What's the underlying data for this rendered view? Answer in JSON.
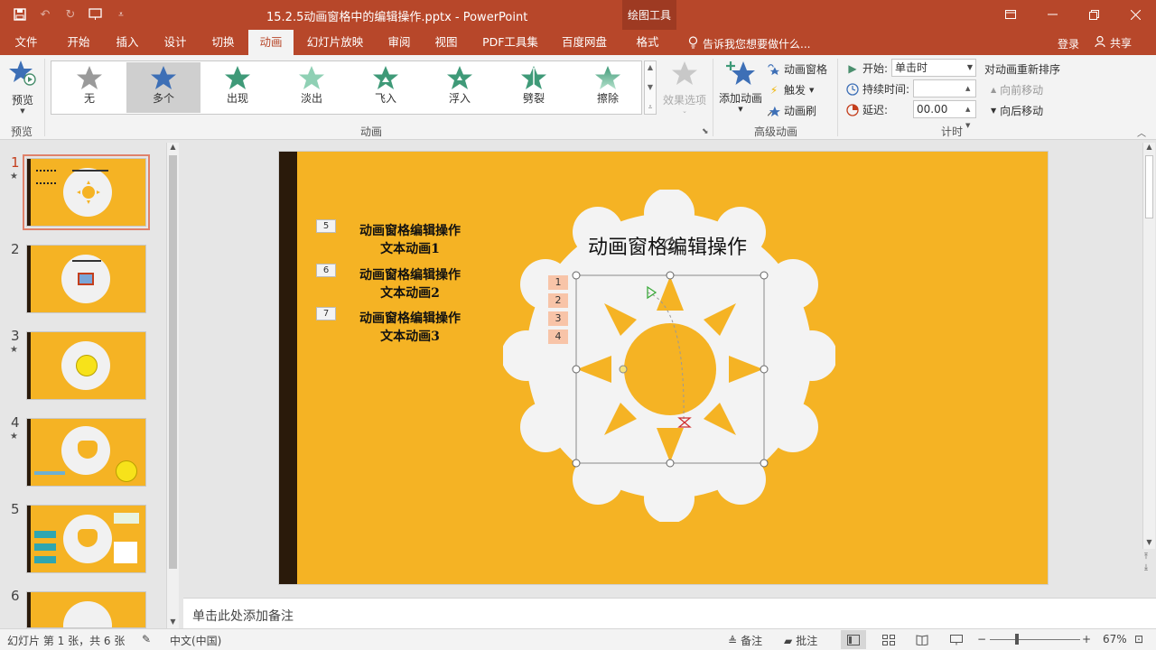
{
  "titlebar": {
    "doc_title": "15.2.5动画窗格中的编辑操作.pptx - PowerPoint",
    "context_tab": "绘图工具"
  },
  "tabs": [
    {
      "label": "文件"
    },
    {
      "label": "开始"
    },
    {
      "label": "插入"
    },
    {
      "label": "设计"
    },
    {
      "label": "切换"
    },
    {
      "label": "动画"
    },
    {
      "label": "幻灯片放映"
    },
    {
      "label": "审阅"
    },
    {
      "label": "视图"
    },
    {
      "label": "PDF工具集"
    },
    {
      "label": "百度网盘"
    },
    {
      "label": "格式"
    }
  ],
  "tellme": "告诉我您想要做什么...",
  "account": {
    "login": "登录",
    "share": "共享"
  },
  "ribbon": {
    "preview": {
      "label": "预览",
      "group": "预览"
    },
    "gallery": {
      "group": "动画",
      "items": [
        {
          "label": "无",
          "color": "#9a9a9a"
        },
        {
          "label": "多个",
          "color": "#3d6fb6"
        },
        {
          "label": "出现",
          "color": "#3f9a78"
        },
        {
          "label": "淡出",
          "color": "#6fc0a0"
        },
        {
          "label": "飞入",
          "color": "#3f9a78"
        },
        {
          "label": "浮入",
          "color": "#3f9a78"
        },
        {
          "label": "劈裂",
          "color": "#3f9a78"
        },
        {
          "label": "擦除",
          "color": "#5fb08e"
        }
      ]
    },
    "effect_options": "效果选项",
    "advanced": {
      "group": "高级动画",
      "add_animation": "添加动画",
      "animation_pane": "动画窗格",
      "trigger": "触发",
      "animation_painter": "动画刷"
    },
    "timing": {
      "group": "计时",
      "start_label": "开始:",
      "start_value": "单击时",
      "duration_label": "持续时间:",
      "duration_value": "",
      "delay_label": "延迟:",
      "delay_value": "00.00",
      "reorder_title": "对动画重新排序",
      "move_earlier": "向前移动",
      "move_later": "向后移动"
    }
  },
  "thumbnails": [
    {
      "num": "1",
      "star": "★"
    },
    {
      "num": "2",
      "star": ""
    },
    {
      "num": "3",
      "star": "★"
    },
    {
      "num": "4",
      "star": "★"
    },
    {
      "num": "5",
      "star": ""
    },
    {
      "num": "6",
      "star": ""
    }
  ],
  "slide": {
    "title": "动画窗格编辑操作",
    "text_items": [
      {
        "tag": "5",
        "line1": "动画窗格编辑操作",
        "line2": "文本动画1"
      },
      {
        "tag": "6",
        "line1": "动画窗格编辑操作",
        "line2": "文本动画2"
      },
      {
        "tag": "7",
        "line1": "动画窗格编辑操作",
        "line2": "文本动画3"
      }
    ],
    "sun_tags": [
      "1",
      "2",
      "3",
      "4"
    ]
  },
  "notes": "单击此处添加备注",
  "status": {
    "slide_info": "幻灯片 第 1 张，共 6 张",
    "language": "中文(中国)",
    "notes_btn": "备注",
    "comments_btn": "批注",
    "zoom": "67%"
  },
  "colors": {
    "accent": "#b7472a",
    "slide_bg": "#f5b324",
    "slide_bar": "#2a1a0a"
  }
}
